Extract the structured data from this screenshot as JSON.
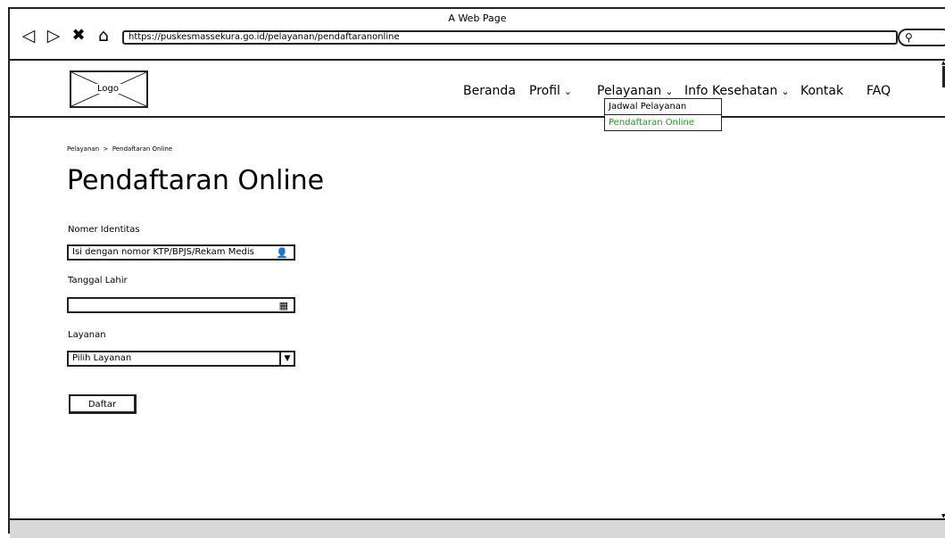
{
  "window": {
    "title": "A Web Page"
  },
  "browser": {
    "url": "https://puskesmassekura.go.id/pelayanan/pendaftaranonline",
    "icons": [
      "back-icon",
      "forward-icon",
      "close-icon",
      "home-icon",
      "search-icon"
    ]
  },
  "header": {
    "logo_text": "Logo",
    "menu": [
      {
        "label": "Beranda",
        "has_dropdown": false
      },
      {
        "label": "Profil",
        "has_dropdown": true
      },
      {
        "label": "Pelayanan",
        "has_dropdown": true
      },
      {
        "label": "Info Kesehatan",
        "has_dropdown": true
      },
      {
        "label": "Kontak",
        "has_dropdown": false
      },
      {
        "label": "FAQ",
        "has_dropdown": false
      }
    ],
    "dropdown": {
      "items": [
        {
          "label": "Jadwal Pelayanan"
        },
        {
          "label": "Pendaftaran Online"
        }
      ]
    }
  },
  "breadcrumb": {
    "text": "Pelayanan  >  Pendaftaran Online"
  },
  "page": {
    "title": "Pendaftaran Online"
  },
  "form": {
    "id_label": "Nomer Identitas",
    "id_placeholder": "Isi dengan nomor KTP/BPJS/Rekam Medis",
    "dob_label": "Tanggal Lahir",
    "dob_value": "",
    "service_label": "Layanan",
    "service_selected": "Pilih Layanan",
    "submit_label": "Daftar"
  },
  "colors": {
    "active_link": "#1a9c1a",
    "border": "#222222",
    "footer": "#d8d8d8"
  }
}
